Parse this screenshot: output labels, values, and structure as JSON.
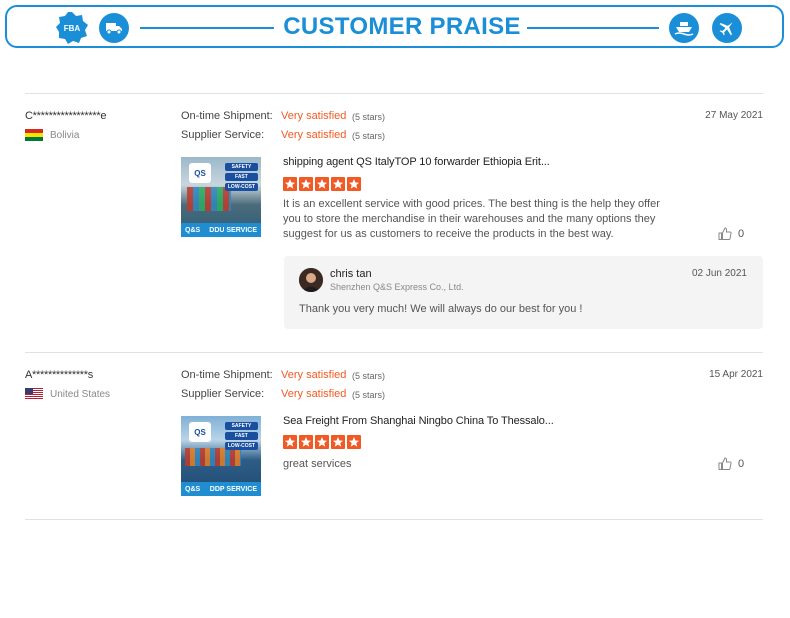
{
  "banner": {
    "title": "CUSTOMER PRAISE",
    "fba_text": "FBA",
    "icons": [
      "fba-icon",
      "truck-icon",
      "ship-icon",
      "airplane-icon"
    ],
    "color": "#1a8fd8"
  },
  "reviews": [
    {
      "reviewer": "C*****************e",
      "country": "Bolivia",
      "shipment_label": "On-time Shipment:",
      "shipment_value": "Very satisfied",
      "shipment_stars": "(5 stars)",
      "service_label": "Supplier Service:",
      "service_value": "Very satisfied",
      "service_stars": "(5 stars)",
      "date": "27 May 2021",
      "product_title": "shipping agent QS ItalyTOP 10 forwarder Ethiopia Erit...",
      "product_img_left": "Q&S",
      "product_img_right": "DDU SERVICE",
      "product_img_tags": [
        "SAFETY",
        "FAST",
        "LOW-COST"
      ],
      "rating": 5,
      "text": "It is an excellent service with good prices. The best thing is the help they offer you to store the merchandise in their warehouses and the many options they suggest for us as customers to receive the products in the best way.",
      "likes": "0",
      "reply": {
        "name": "chris tan",
        "company": "Shenzhen Q&S Express Co., Ltd.",
        "date": "02 Jun 2021",
        "text": "Thank you very much!  We will always do our best for you !"
      }
    },
    {
      "reviewer": "A**************s",
      "country": "United States",
      "shipment_label": "On-time Shipment:",
      "shipment_value": "Very satisfied",
      "shipment_stars": "(5 stars)",
      "service_label": "Supplier Service:",
      "service_value": "Very satisfied",
      "service_stars": "(5 stars)",
      "date": "15 Apr 2021",
      "product_title": "Sea Freight From Shanghai Ningbo China To Thessalo...",
      "product_img_left": "Q&S",
      "product_img_right": "DDP SERVICE",
      "product_img_tags": [
        "SAFETY",
        "FAST",
        "LOW-COST"
      ],
      "rating": 5,
      "text": "great services",
      "likes": "0"
    }
  ],
  "qs_logo_text": "QS",
  "accent_color": "#f15a24"
}
